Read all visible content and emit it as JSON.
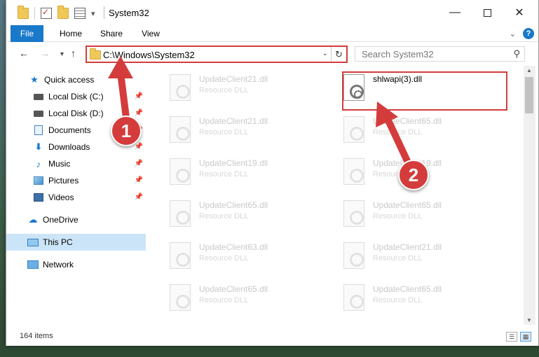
{
  "window": {
    "title": "System32",
    "controls": {
      "minimize": "—",
      "maximize": "",
      "close": "✕"
    }
  },
  "ribbon": {
    "tabs": [
      "File",
      "Home",
      "Share",
      "View"
    ],
    "help": "?"
  },
  "address": {
    "path": "C:\\Windows\\System32",
    "search_placeholder": "Search System32"
  },
  "sidebar": {
    "items": [
      {
        "label": "Quick access",
        "icon": "star-icon",
        "pinned": false
      },
      {
        "label": "Local Disk (C:)",
        "icon": "disk-icon",
        "pinned": true
      },
      {
        "label": "Local Disk (D:)",
        "icon": "disk-icon",
        "pinned": true
      },
      {
        "label": "Documents",
        "icon": "document-icon",
        "pinned": true
      },
      {
        "label": "Downloads",
        "icon": "download-icon",
        "pinned": true
      },
      {
        "label": "Music",
        "icon": "music-icon",
        "pinned": true
      },
      {
        "label": "Pictures",
        "icon": "picture-icon",
        "pinned": true
      },
      {
        "label": "Videos",
        "icon": "video-icon",
        "pinned": true
      },
      {
        "label": "OneDrive",
        "icon": "cloud-icon",
        "pinned": false
      },
      {
        "label": "This PC",
        "icon": "computer-icon",
        "pinned": false,
        "selected": true
      },
      {
        "label": "Network",
        "icon": "network-icon",
        "pinned": false
      }
    ]
  },
  "files": [
    {
      "name": "UpdateClient21.dll",
      "desc": "Resource DLL"
    },
    {
      "name": "shlwapi(3).dll",
      "desc": "",
      "highlighted": true
    },
    {
      "name": "UpdateClient21.dll",
      "desc": "Resource DLL"
    },
    {
      "name": "UpdateClient65.dll",
      "desc": "Resource DLL"
    },
    {
      "name": "UpdateClient19.dll",
      "desc": "Resource DLL"
    },
    {
      "name": "UpdateClient19.dll",
      "desc": "Resource DLL"
    },
    {
      "name": "UpdateClient65.dll",
      "desc": "Resource DLL"
    },
    {
      "name": "UpdateClient65.dll",
      "desc": "Resource DLL"
    },
    {
      "name": "UpdateClient63.dll",
      "desc": "Resource DLL"
    },
    {
      "name": "UpdateClient21.dll",
      "desc": "Resource DLL"
    },
    {
      "name": "UpdateClient65.dll",
      "desc": "Resource DLL"
    },
    {
      "name": "UpdateClient65.dll",
      "desc": "Resource DLL"
    }
  ],
  "status": {
    "item_count": "164 items"
  },
  "annotations": {
    "callout1": "1",
    "callout2": "2",
    "color": "#d43c3c"
  }
}
